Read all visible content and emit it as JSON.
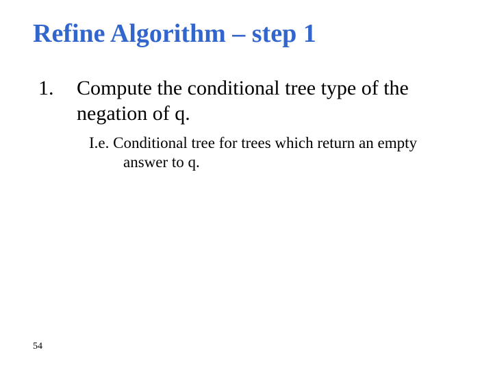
{
  "title": "Refine Algorithm – step 1",
  "list": {
    "marker": "1.",
    "text": "Compute the conditional tree type of the negation of q."
  },
  "note": "I.e. Conditional tree for trees which return an empty answer to q.",
  "page_number": "54"
}
